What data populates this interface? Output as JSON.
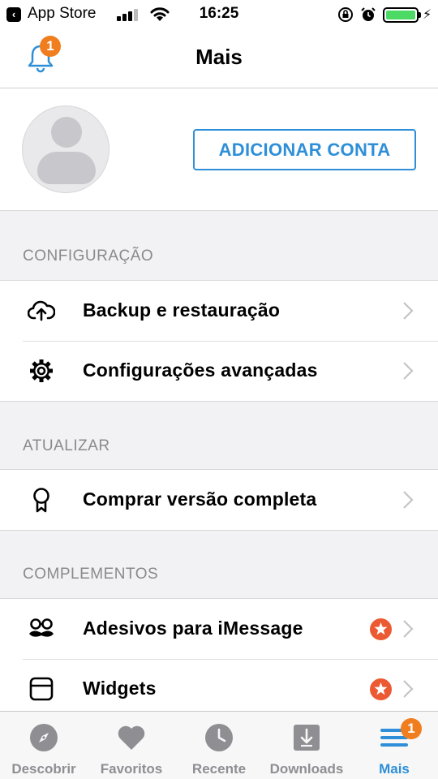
{
  "status_bar": {
    "back_app": "App Store",
    "time": "16:25",
    "battery_level": 1.0
  },
  "nav": {
    "title": "Mais",
    "notification_count": "1"
  },
  "account": {
    "add_account_label": "ADICIONAR CONTA"
  },
  "sections": {
    "config": {
      "header": "CONFIGURAÇÃO",
      "items": [
        {
          "label": "Backup e restauração",
          "icon": "cloud-upload-icon"
        },
        {
          "label": "Configurações avançadas",
          "icon": "gear-icon"
        }
      ]
    },
    "update": {
      "header": "ATUALIZAR",
      "items": [
        {
          "label": "Comprar versão completa",
          "icon": "ribbon-award-icon"
        }
      ]
    },
    "addons": {
      "header": "COMPLEMENTOS",
      "items": [
        {
          "label": "Adesivos para iMessage",
          "icon": "mustache-glasses-icon",
          "premium": true
        },
        {
          "label": "Widgets",
          "icon": "widget-icon",
          "premium": true
        }
      ]
    }
  },
  "tabs": [
    {
      "label": "Descobrir",
      "icon": "compass-icon"
    },
    {
      "label": "Favoritos",
      "icon": "heart-icon"
    },
    {
      "label": "Recente",
      "icon": "clock-icon"
    },
    {
      "label": "Downloads",
      "icon": "download-icon"
    },
    {
      "label": "Mais",
      "icon": "menu-icon",
      "active": true,
      "badge": "1"
    }
  ],
  "colors": {
    "accent": "#2e8fd8",
    "badge": "#f07d1e",
    "premium": "#ec5a34",
    "inactive": "#8e8e93"
  }
}
